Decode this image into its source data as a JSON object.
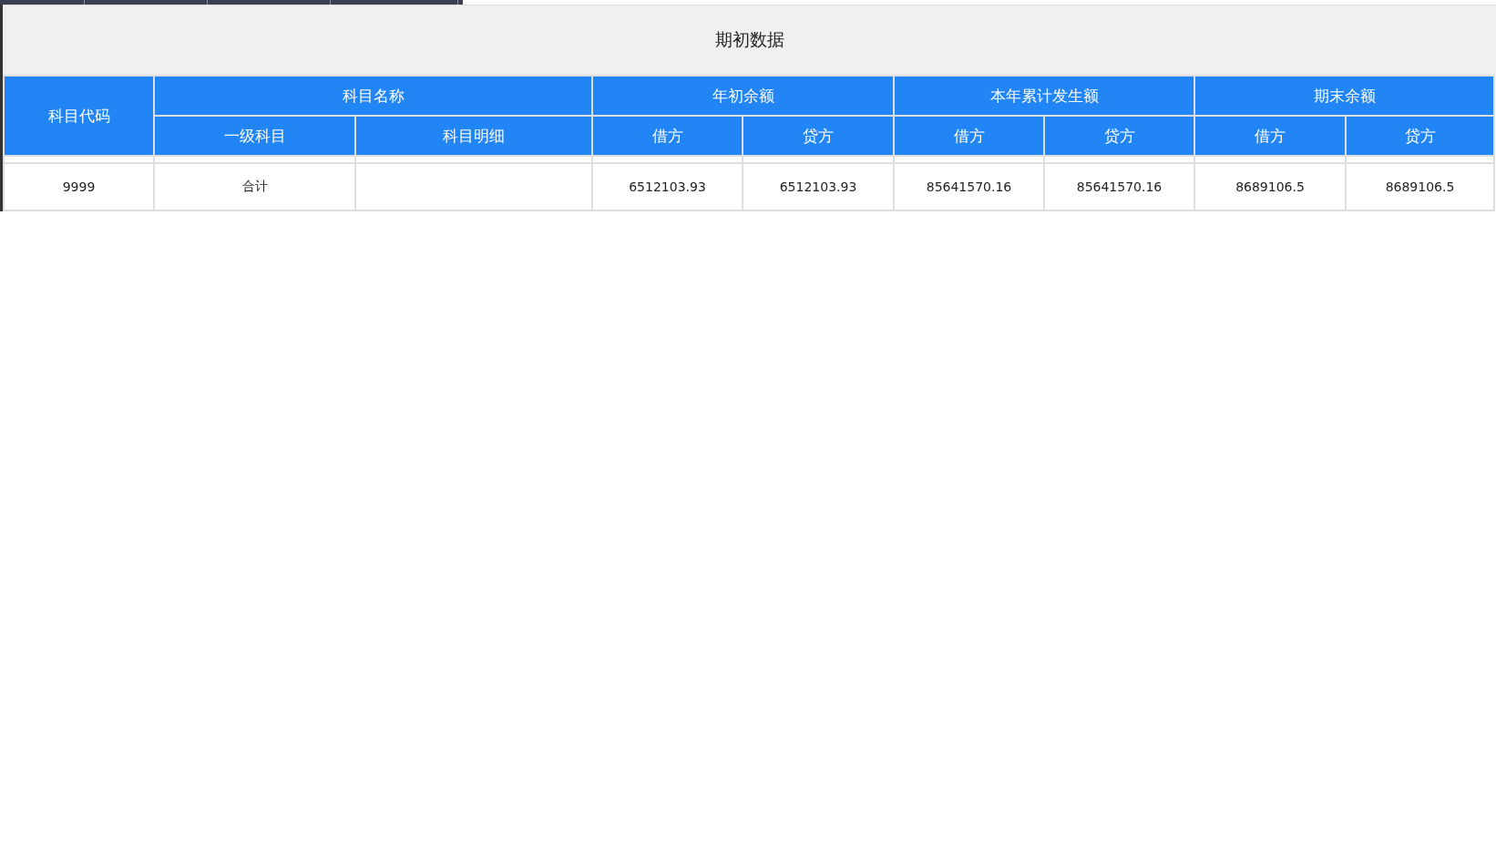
{
  "title": "期初数据",
  "header_groups": [
    {
      "label": "科目代码"
    },
    {
      "label": "科目名称",
      "children": [
        "一级科目",
        "科目明细"
      ]
    },
    {
      "label": "年初余额",
      "children": [
        "借方",
        "贷方"
      ]
    },
    {
      "label": "本年累计发生额",
      "children": [
        "借方",
        "贷方"
      ]
    },
    {
      "label": "期末余额",
      "children": [
        "借方",
        "贷方"
      ]
    }
  ],
  "rows": [
    {
      "cells": [
        "9999",
        "合计",
        null,
        "6512103.93",
        "6512103.93",
        "85641570.16",
        "85641570.16",
        "8689106.5",
        "8689106.5"
      ]
    }
  ]
}
